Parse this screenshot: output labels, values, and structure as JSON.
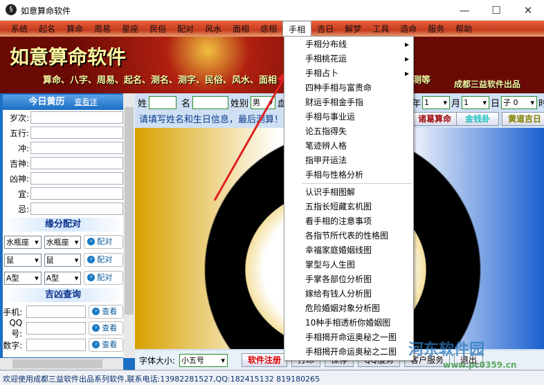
{
  "window": {
    "title": "如意算命软件",
    "min": "—",
    "max": "☐",
    "close": "✕"
  },
  "menu": [
    "系统",
    "起名",
    "算命",
    "周易",
    "星座",
    "民俗",
    "配对",
    "风水",
    "面相",
    "痣相",
    "手相",
    "吉日",
    "解梦",
    "工具",
    "造命",
    "服务",
    "帮助"
  ],
  "banner": {
    "title": "如意算命软件",
    "subtitle": "算命、八字、周易、起名、测名、测字、民俗、风水、面相",
    "subtitle_tail": "测等",
    "publisher": "成都三益软件出品"
  },
  "left": {
    "almanac_title": "今日黄历",
    "almanac_link": "查看详",
    "almanac_fields": [
      "岁次:",
      "五行:",
      "冲:",
      "吉神:",
      "凶神:",
      "宜:",
      "忌:"
    ],
    "match_title": "缘分配对",
    "match_rows": [
      [
        "水瓶座",
        "水瓶座"
      ],
      [
        "鼠",
        "鼠"
      ],
      [
        "A型",
        "A型"
      ]
    ],
    "match_button": "配对",
    "query_title": "吉凶查询",
    "query_fields": [
      "手机:",
      "QQ号:",
      "数字:"
    ],
    "query_button": "查看"
  },
  "form": {
    "surname_label": "姓",
    "name_label": "名",
    "gender_label": "姓别",
    "gender": "男",
    "blood_label": "血",
    "year_label": "年",
    "year": "1",
    "month_label": "月",
    "month": "1",
    "day_label": "日",
    "hour": "子 0",
    "hour_label": "时",
    "tip": "请填写姓名和生日信息，最后测算！",
    "btn_zhuge": "诸葛算命",
    "btn_jinqian": "金钱卦",
    "btn_huangdao": "黄道吉日"
  },
  "bottom": {
    "font_label": "字体大小:",
    "font_size": "小五号",
    "register": "软件注册",
    "print": "打印",
    "save": "保存",
    "qq": "QQ服务",
    "service": "客户服务",
    "exit": "退出"
  },
  "status": "欢迎使用成都三益软件出品系列软件,联系电话:13982281527,QQ:182415132 819180265",
  "dropdown": {
    "sub": [
      "手相分布线",
      "手相桃花运",
      "手相占卜"
    ],
    "group1": [
      "四种手相与富贵命",
      "财运手相金手指",
      "手相与事业运",
      "论五指得失",
      "笔迹辨人格",
      "指甲开运法",
      "手相与性格分析"
    ],
    "group2": [
      "认识手相图解",
      "五指长短藏玄机图",
      "看手相的注意事项",
      "各指节所代表的性格图",
      "幸福家庭婚姻线图",
      "掌型与人生图",
      "手掌各部位分析图",
      "嫁给有钱人分析图",
      "危险婚姻对象分析图",
      "10种手相透析你婚姻图",
      "手相揭开命运奥秘之一图",
      "手相揭开命运奥秘之二图"
    ]
  },
  "watermark": {
    "name": "河东软件园",
    "url": "www.pc0359.cn"
  }
}
